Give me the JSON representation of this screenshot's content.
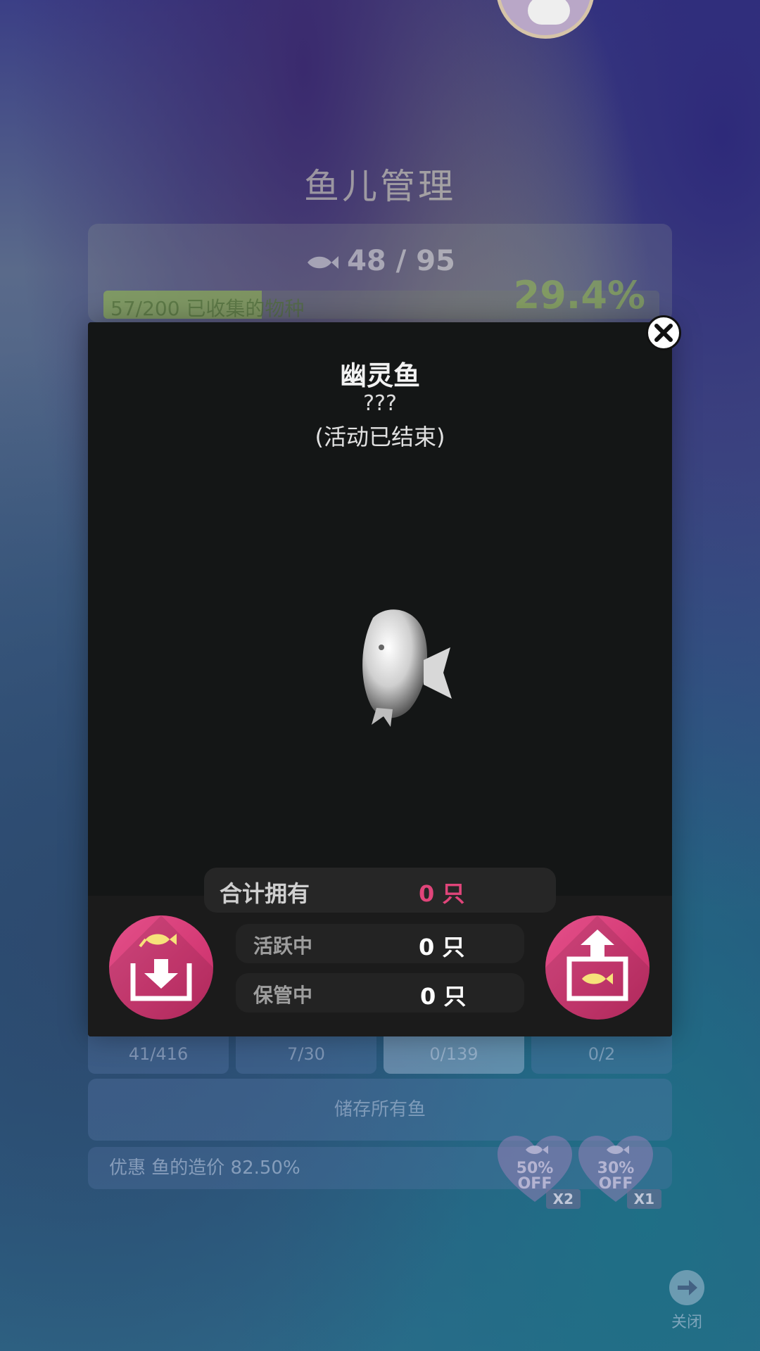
{
  "background": {
    "title": "鱼儿管理",
    "fish_count": "48 / 95",
    "collection_text": "57/200 已收集的物种",
    "collection_percent": "29.4%",
    "collection_progress": 0.285,
    "tabs": [
      {
        "label": "41/416",
        "active": false
      },
      {
        "label": "7/30",
        "active": false
      },
      {
        "label": "0/139",
        "active": true
      },
      {
        "label": "0/2",
        "active": false
      }
    ],
    "store_all_label": "储存所有鱼",
    "discount_text": "优惠 鱼的造价 82.50%",
    "coupons": [
      {
        "percent": "50%",
        "off": "OFF",
        "multiplier": "X2"
      },
      {
        "percent": "30%",
        "off": "OFF",
        "multiplier": "X1"
      }
    ],
    "close_label": "关闭"
  },
  "dialog": {
    "fish_name": "幽灵鱼",
    "scientific_name": "???",
    "status": "(活动已结束)",
    "stats": {
      "total_label": "合计拥有",
      "total_value": "0 只",
      "active_label": "活跃中",
      "active_value": "0 只",
      "stored_label": "保管中",
      "stored_value": "0 只"
    }
  },
  "colors": {
    "accent_pink": "#d43a75",
    "total_value_color": "#e0457a",
    "progress_green": "#96be50"
  },
  "icons": [
    "close-icon",
    "fish-icon",
    "store-fish-icon",
    "deploy-fish-icon",
    "arrow-right-icon",
    "heart-coupon-icon"
  ]
}
